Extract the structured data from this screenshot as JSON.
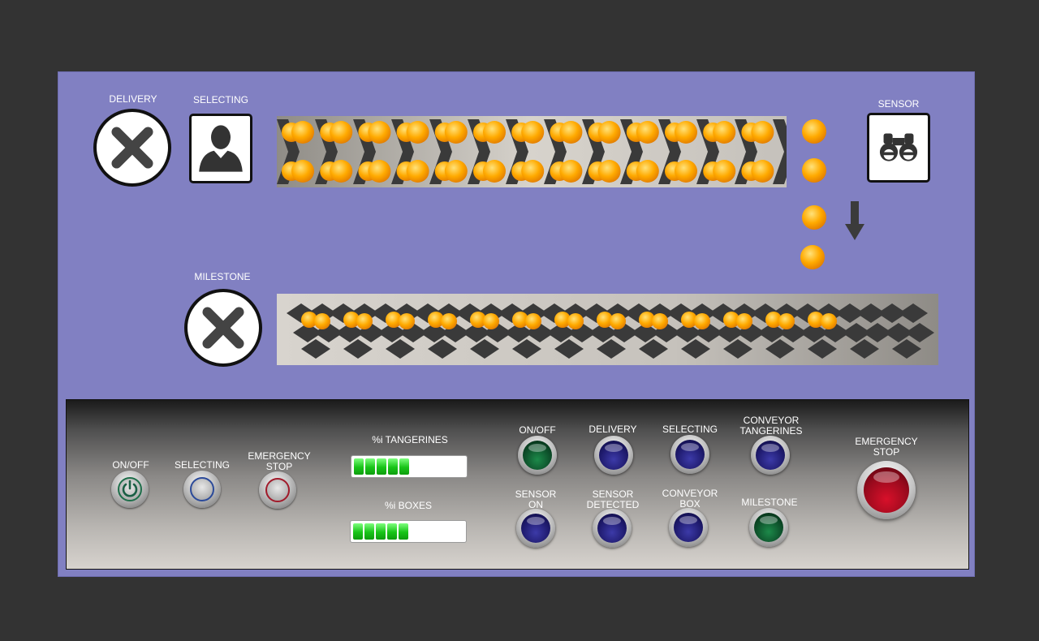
{
  "scene": {
    "delivery_label": "DELIVERY",
    "selecting_label": "SELECTING",
    "sensor_label": "SENSOR",
    "milestone_label": "MILESTONE"
  },
  "controls": {
    "onoff_label": "ON/OFF",
    "selecting_label": "SELECTING",
    "emergency_label_1": "EMERGENCY",
    "emergency_label_2": "STOP",
    "tangerines_bar_label": "%i TANGERINES",
    "tangerines_level": 0.5,
    "boxes_bar_label": "%i BOXES",
    "boxes_level": 0.5,
    "indicators": {
      "onoff": "ON/OFF",
      "delivery": "DELIVERY",
      "selecting": "SELECTING",
      "conveyor_tangerines_1": "CONVEYOR",
      "conveyor_tangerines_2": "TANGERINES",
      "sensor_on_1": "SENSOR",
      "sensor_on_2": "ON",
      "sensor_detected_1": "SENSOR",
      "sensor_detected_2": "DETECTED",
      "conveyor_box_1": "CONVEYOR",
      "conveyor_box_2": "BOX",
      "milestone": "MILESTONE"
    },
    "big_emergency_1": "EMERGENCY",
    "big_emergency_2": "STOP"
  },
  "colors": {
    "panel": "#8180c2",
    "tangerine": "#ffaa00",
    "lamp_blue": "#1f1b6e",
    "lamp_green": "#0d4f2a",
    "estop_red": "#9a0a1d"
  },
  "icons": {
    "delivery": "x-circle-icon",
    "selecting": "user-silhouette-icon",
    "sensor": "binoculars-icon",
    "milestone": "x-circle-icon",
    "flow": "arrow-down-icon"
  }
}
